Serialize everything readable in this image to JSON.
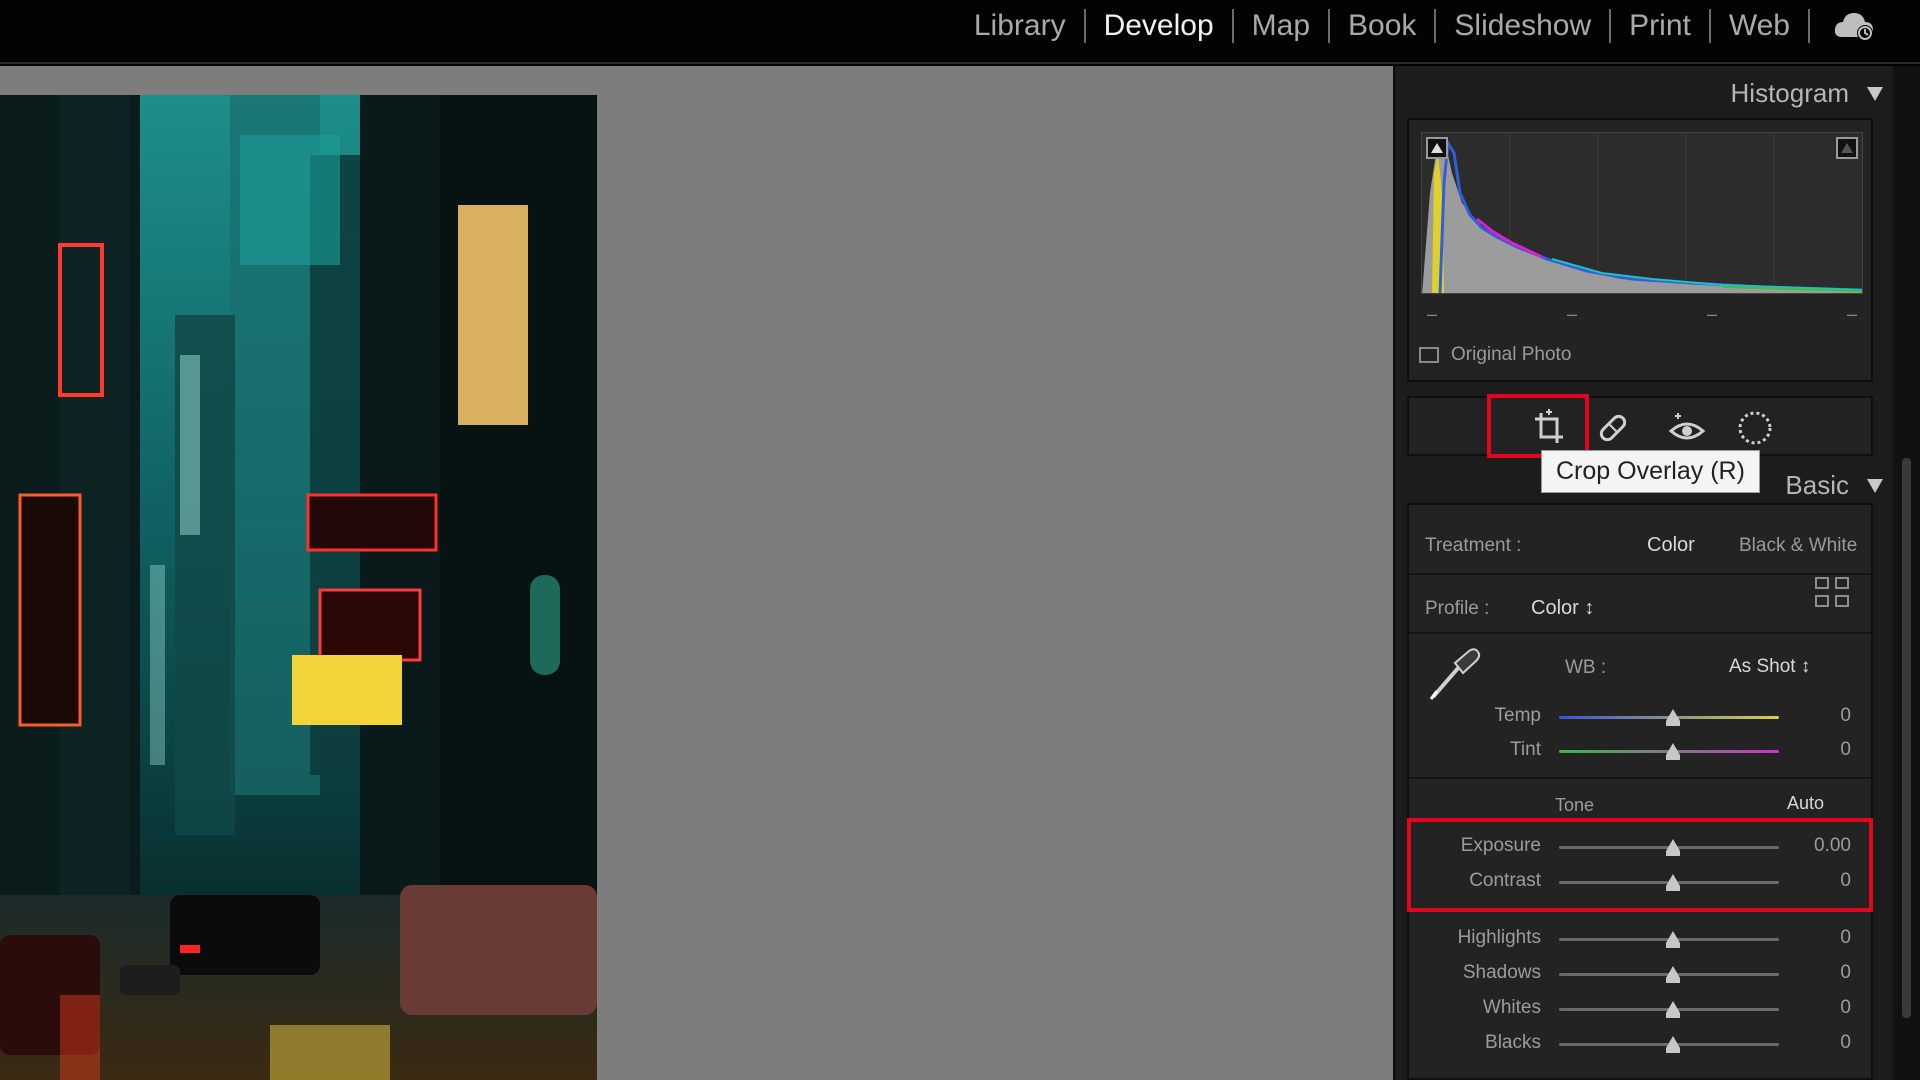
{
  "modules": [
    "Library",
    "Develop",
    "Map",
    "Book",
    "Slideshow",
    "Print",
    "Web"
  ],
  "active_module": "Develop",
  "histogram": {
    "title": "Histogram",
    "dashes": [
      "–",
      "–",
      "–",
      "–"
    ],
    "original_photo_label": "Original Photo"
  },
  "tools": {
    "tooltip": "Crop Overlay (R)",
    "items": [
      "crop-overlay",
      "spot-removal",
      "red-eye-correction",
      "masking"
    ]
  },
  "basic": {
    "title": "Basic",
    "treatment_label": "Treatment :",
    "treatment_color": "Color",
    "treatment_bw": "Black & White",
    "profile_label": "Profile :",
    "profile_value": "Color ↕",
    "wb_label": "WB :",
    "wb_value": "As Shot ↕",
    "temp_label": "Temp",
    "temp_value": "0",
    "tint_label": "Tint",
    "tint_value": "0",
    "tone_label": "Tone",
    "auto_label": "Auto",
    "exposure_label": "Exposure",
    "exposure_value": "0.00",
    "contrast_label": "Contrast",
    "contrast_value": "0",
    "highlights_label": "Highlights",
    "highlights_value": "0",
    "shadows_label": "Shadows",
    "shadows_value": "0",
    "whites_label": "Whites",
    "whites_value": "0",
    "blacks_label": "Blacks",
    "blacks_value": "0"
  },
  "colors": {
    "highlight": "#e2051b",
    "panel": "#232323",
    "workspace": "#7d7d7d"
  }
}
